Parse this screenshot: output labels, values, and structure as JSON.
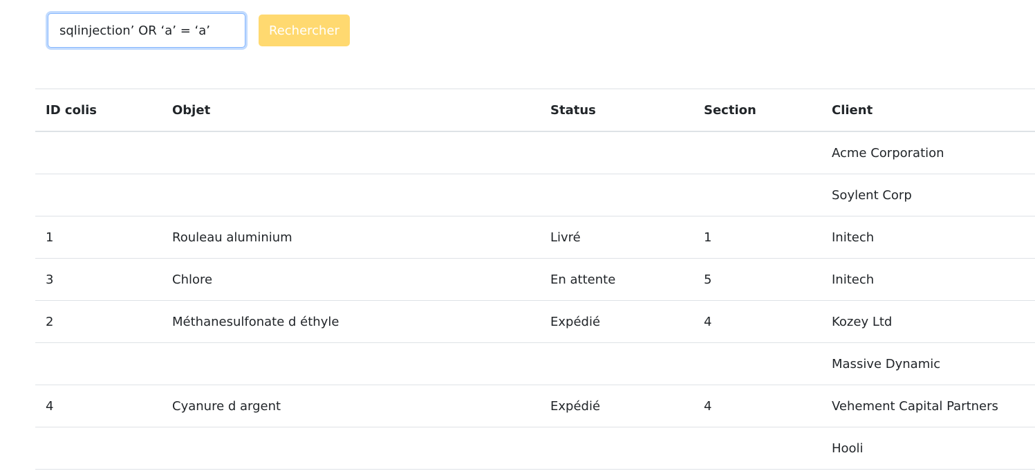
{
  "search": {
    "value": "sqlinjection’ OR ‘a’ = ‘a’",
    "button_label": "Rechercher"
  },
  "table": {
    "headers": {
      "id": "ID colis",
      "objet": "Objet",
      "status": "Status",
      "section": "Section",
      "client": "Client"
    },
    "rows": [
      {
        "id": "",
        "objet": "",
        "status": "",
        "section": "",
        "client": "Acme Corporation"
      },
      {
        "id": "",
        "objet": "",
        "status": "",
        "section": "",
        "client": "Soylent Corp"
      },
      {
        "id": "1",
        "objet": "Rouleau aluminium",
        "status": "Livré",
        "section": "1",
        "client": "Initech"
      },
      {
        "id": "3",
        "objet": "Chlore",
        "status": "En attente",
        "section": "5",
        "client": "Initech"
      },
      {
        "id": "2",
        "objet": "Méthanesulfonate d éthyle",
        "status": "Expédié",
        "section": "4",
        "client": "Kozey Ltd"
      },
      {
        "id": "",
        "objet": "",
        "status": "",
        "section": "",
        "client": "Massive Dynamic"
      },
      {
        "id": "4",
        "objet": "Cyanure d argent",
        "status": "Expédié",
        "section": "4",
        "client": "Vehement Capital Partners"
      },
      {
        "id": "",
        "objet": "",
        "status": "",
        "section": "",
        "client": "Hooli"
      }
    ]
  },
  "colors": {
    "button_bg": "#ffd970",
    "input_focus_border": "#86b7fe",
    "row_border": "#dee2e6"
  }
}
